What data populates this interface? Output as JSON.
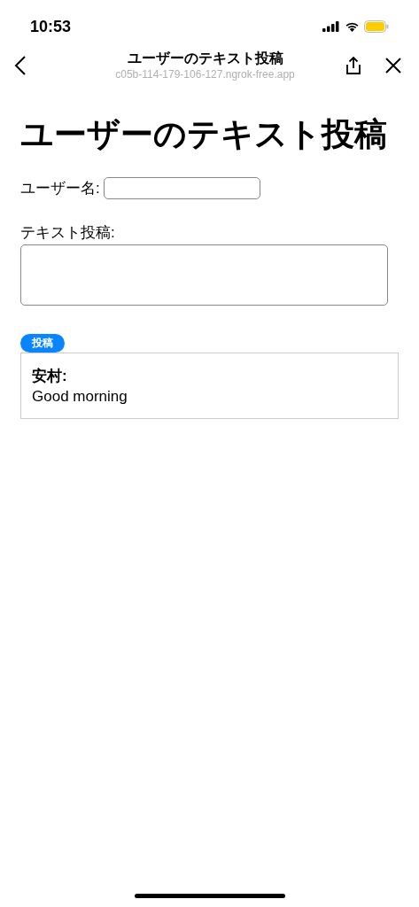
{
  "status_bar": {
    "time": "10:53"
  },
  "browser_bar": {
    "title": "ユーザーのテキスト投稿",
    "url": "c05b-114-179-106-127.ngrok-free.app"
  },
  "page": {
    "heading": "ユーザーのテキスト投稿",
    "username_label": "ユーザー名:",
    "text_label": "テキスト投稿:",
    "submit_button": "投稿",
    "posts": [
      {
        "user": "安村:",
        "text": "Good morning"
      }
    ]
  }
}
